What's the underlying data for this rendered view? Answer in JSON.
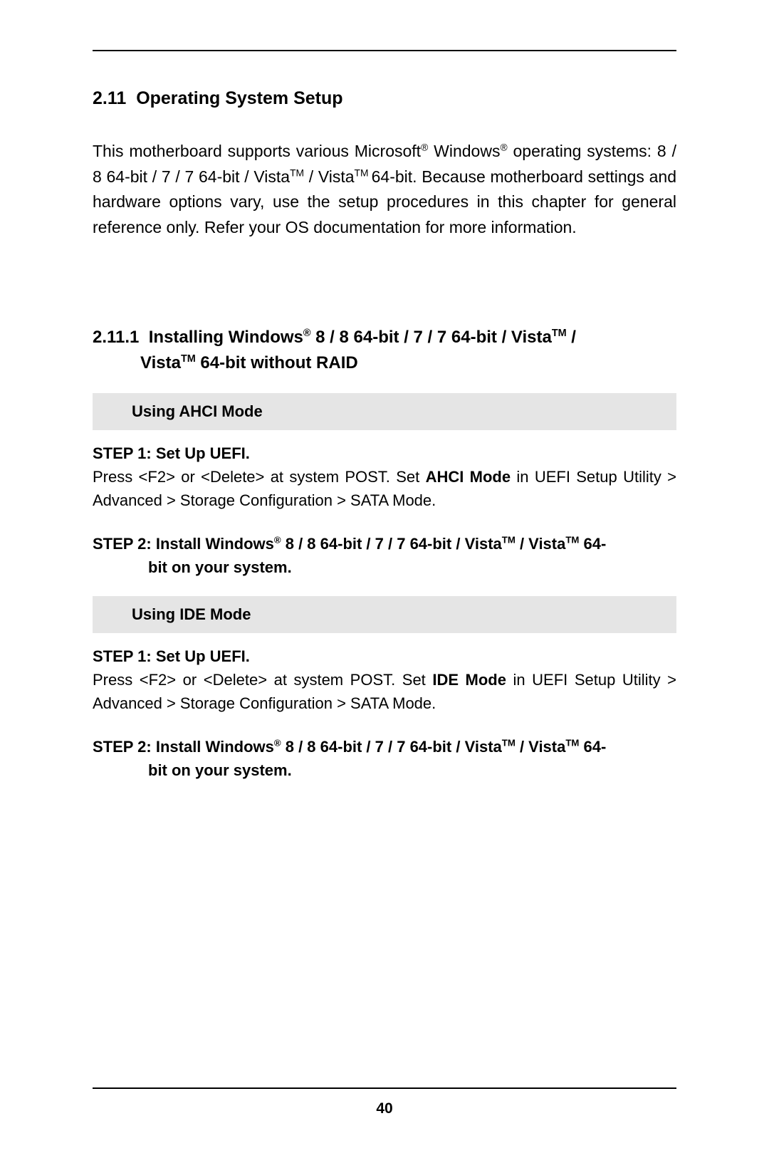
{
  "page_number": "40",
  "section": {
    "number": "2.11",
    "title": "Operating System Setup",
    "intro": {
      "pre1": "This motherboard supports various Microsoft",
      "reg1": "®",
      "mid1": " Windows",
      "reg2": "®",
      "mid2": " operating systems: 8 / 8 64-bit / 7 / 7 64-bit / Vista",
      "tm1": "TM",
      "mid3": " / Vista",
      "tm2": "TM ",
      "tail": "64-bit. Because motherboard settings and hardware options vary, use the setup procedures in this chapter for general reference only. Refer your OS documentation for more information."
    }
  },
  "subsection": {
    "number": "2.11.1",
    "title_pre1": "Installing Windows",
    "title_reg": "®",
    "title_mid1": " 8 / 8 64-bit / 7 / 7 64-bit / Vista",
    "title_tm1": "TM",
    "title_mid2": " / ",
    "title_line2_pre": "Vista",
    "title_line2_tm": "TM",
    "title_line2_tail": " 64-bit without RAID"
  },
  "ahci": {
    "header": "Using AHCI Mode",
    "step1_title": "STEP 1: Set Up UEFI.",
    "step1_body_pre": "Press <F2> or <Delete> at system POST. Set ",
    "step1_body_bold": "AHCI Mode",
    "step1_body_post": " in UEFI Setup Utility > Advanced > Storage Configuration > SATA Mode.",
    "step2_pre": "STEP 2: Install Windows",
    "step2_reg": "®",
    "step2_mid1": " 8 / 8 64-bit / 7 / 7 64-bit / Vista",
    "step2_tm1": "TM",
    "step2_mid2": " / Vista",
    "step2_tm2": "TM",
    "step2_tail1": " 64-",
    "step2_line2": "bit on your system."
  },
  "ide": {
    "header": "Using IDE Mode",
    "step1_title": "STEP 1: Set Up UEFI.",
    "step1_body_pre": "Press <F2> or <Delete> at system POST. Set ",
    "step1_body_bold": "IDE Mode",
    "step1_body_post": " in UEFI Setup Utility > Advanced > Storage Configuration > SATA Mode.",
    "step2_pre": "STEP 2: Install Windows",
    "step2_reg": "®",
    "step2_mid1": " 8 / 8 64-bit / 7 / 7 64-bit / Vista",
    "step2_tm1": "TM",
    "step2_mid2": " / Vista",
    "step2_tm2": "TM",
    "step2_tail1": " 64-",
    "step2_line2": "bit on your system."
  }
}
